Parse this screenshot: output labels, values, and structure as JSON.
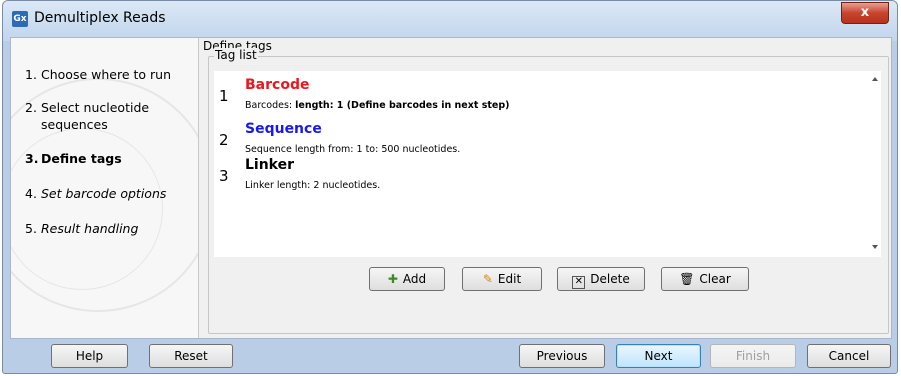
{
  "window": {
    "title": "Demultiplex Reads",
    "app_icon_text": "Gx",
    "close_label": "x"
  },
  "steps": [
    {
      "num": "1.",
      "label": "Choose where to run",
      "style": "normal"
    },
    {
      "num": "2.",
      "label": "Select nucleotide sequences",
      "style": "normal"
    },
    {
      "num": "3.",
      "label": "Define tags",
      "style": "active"
    },
    {
      "num": "4.",
      "label": "Set barcode options",
      "style": "italic"
    },
    {
      "num": "5.",
      "label": "Result handling",
      "style": "italic"
    }
  ],
  "content": {
    "title": "Define tags",
    "group_label": "Tag list",
    "tags": [
      {
        "num": "1",
        "name": "Barcode",
        "color": "#e8181e",
        "desc_prefix": "Barcodes: ",
        "desc_bold": "length: 1 (Define barcodes in next step)",
        "desc": ""
      },
      {
        "num": "2",
        "name": "Sequence",
        "color": "#1a1ae6",
        "desc_prefix": "",
        "desc_bold": "",
        "desc": "Sequence length from: 1 to: 500 nucleotides."
      },
      {
        "num": "3",
        "name": "Linker",
        "color": "#000000",
        "desc_prefix": "",
        "desc_bold": "",
        "desc": "Linker length: 2 nucleotides."
      }
    ],
    "buttons": {
      "add": {
        "label": "Add",
        "icon": "plus-icon"
      },
      "edit": {
        "label": "Edit",
        "icon": "pencil-icon"
      },
      "delete": {
        "label": "Delete",
        "icon": "delete-icon"
      },
      "clear": {
        "label": "Clear",
        "icon": "trash-icon"
      }
    }
  },
  "footer": {
    "help": "Help",
    "reset": "Reset",
    "previous": "Previous",
    "next": "Next",
    "finish": "Finish",
    "cancel": "Cancel"
  }
}
